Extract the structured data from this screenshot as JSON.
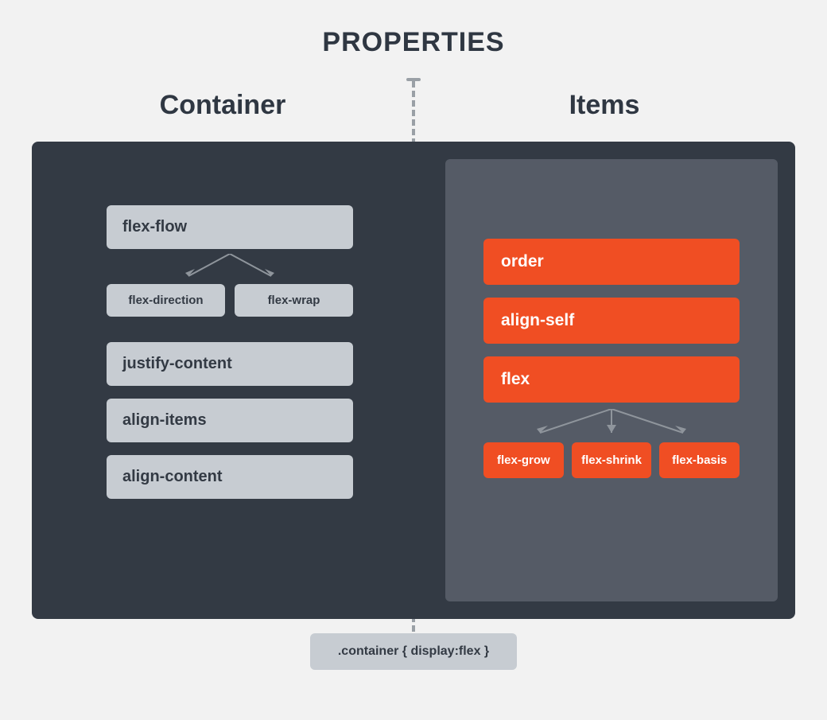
{
  "title": "PROPERTIES",
  "columns": {
    "left": {
      "title": "Container"
    },
    "right": {
      "title": "Items"
    }
  },
  "container": {
    "flex_flow": "flex-flow",
    "flex_direction": "flex-direction",
    "flex_wrap": "flex-wrap",
    "justify_content": "justify-content",
    "align_items": "align-items",
    "align_content": "align-content"
  },
  "items": {
    "order": "order",
    "align_self": "align-self",
    "flex": "flex",
    "flex_grow": "flex-grow",
    "flex_shrink": "flex-shrink",
    "flex_basis": "flex-basis"
  },
  "footer": ".container { display:flex }"
}
